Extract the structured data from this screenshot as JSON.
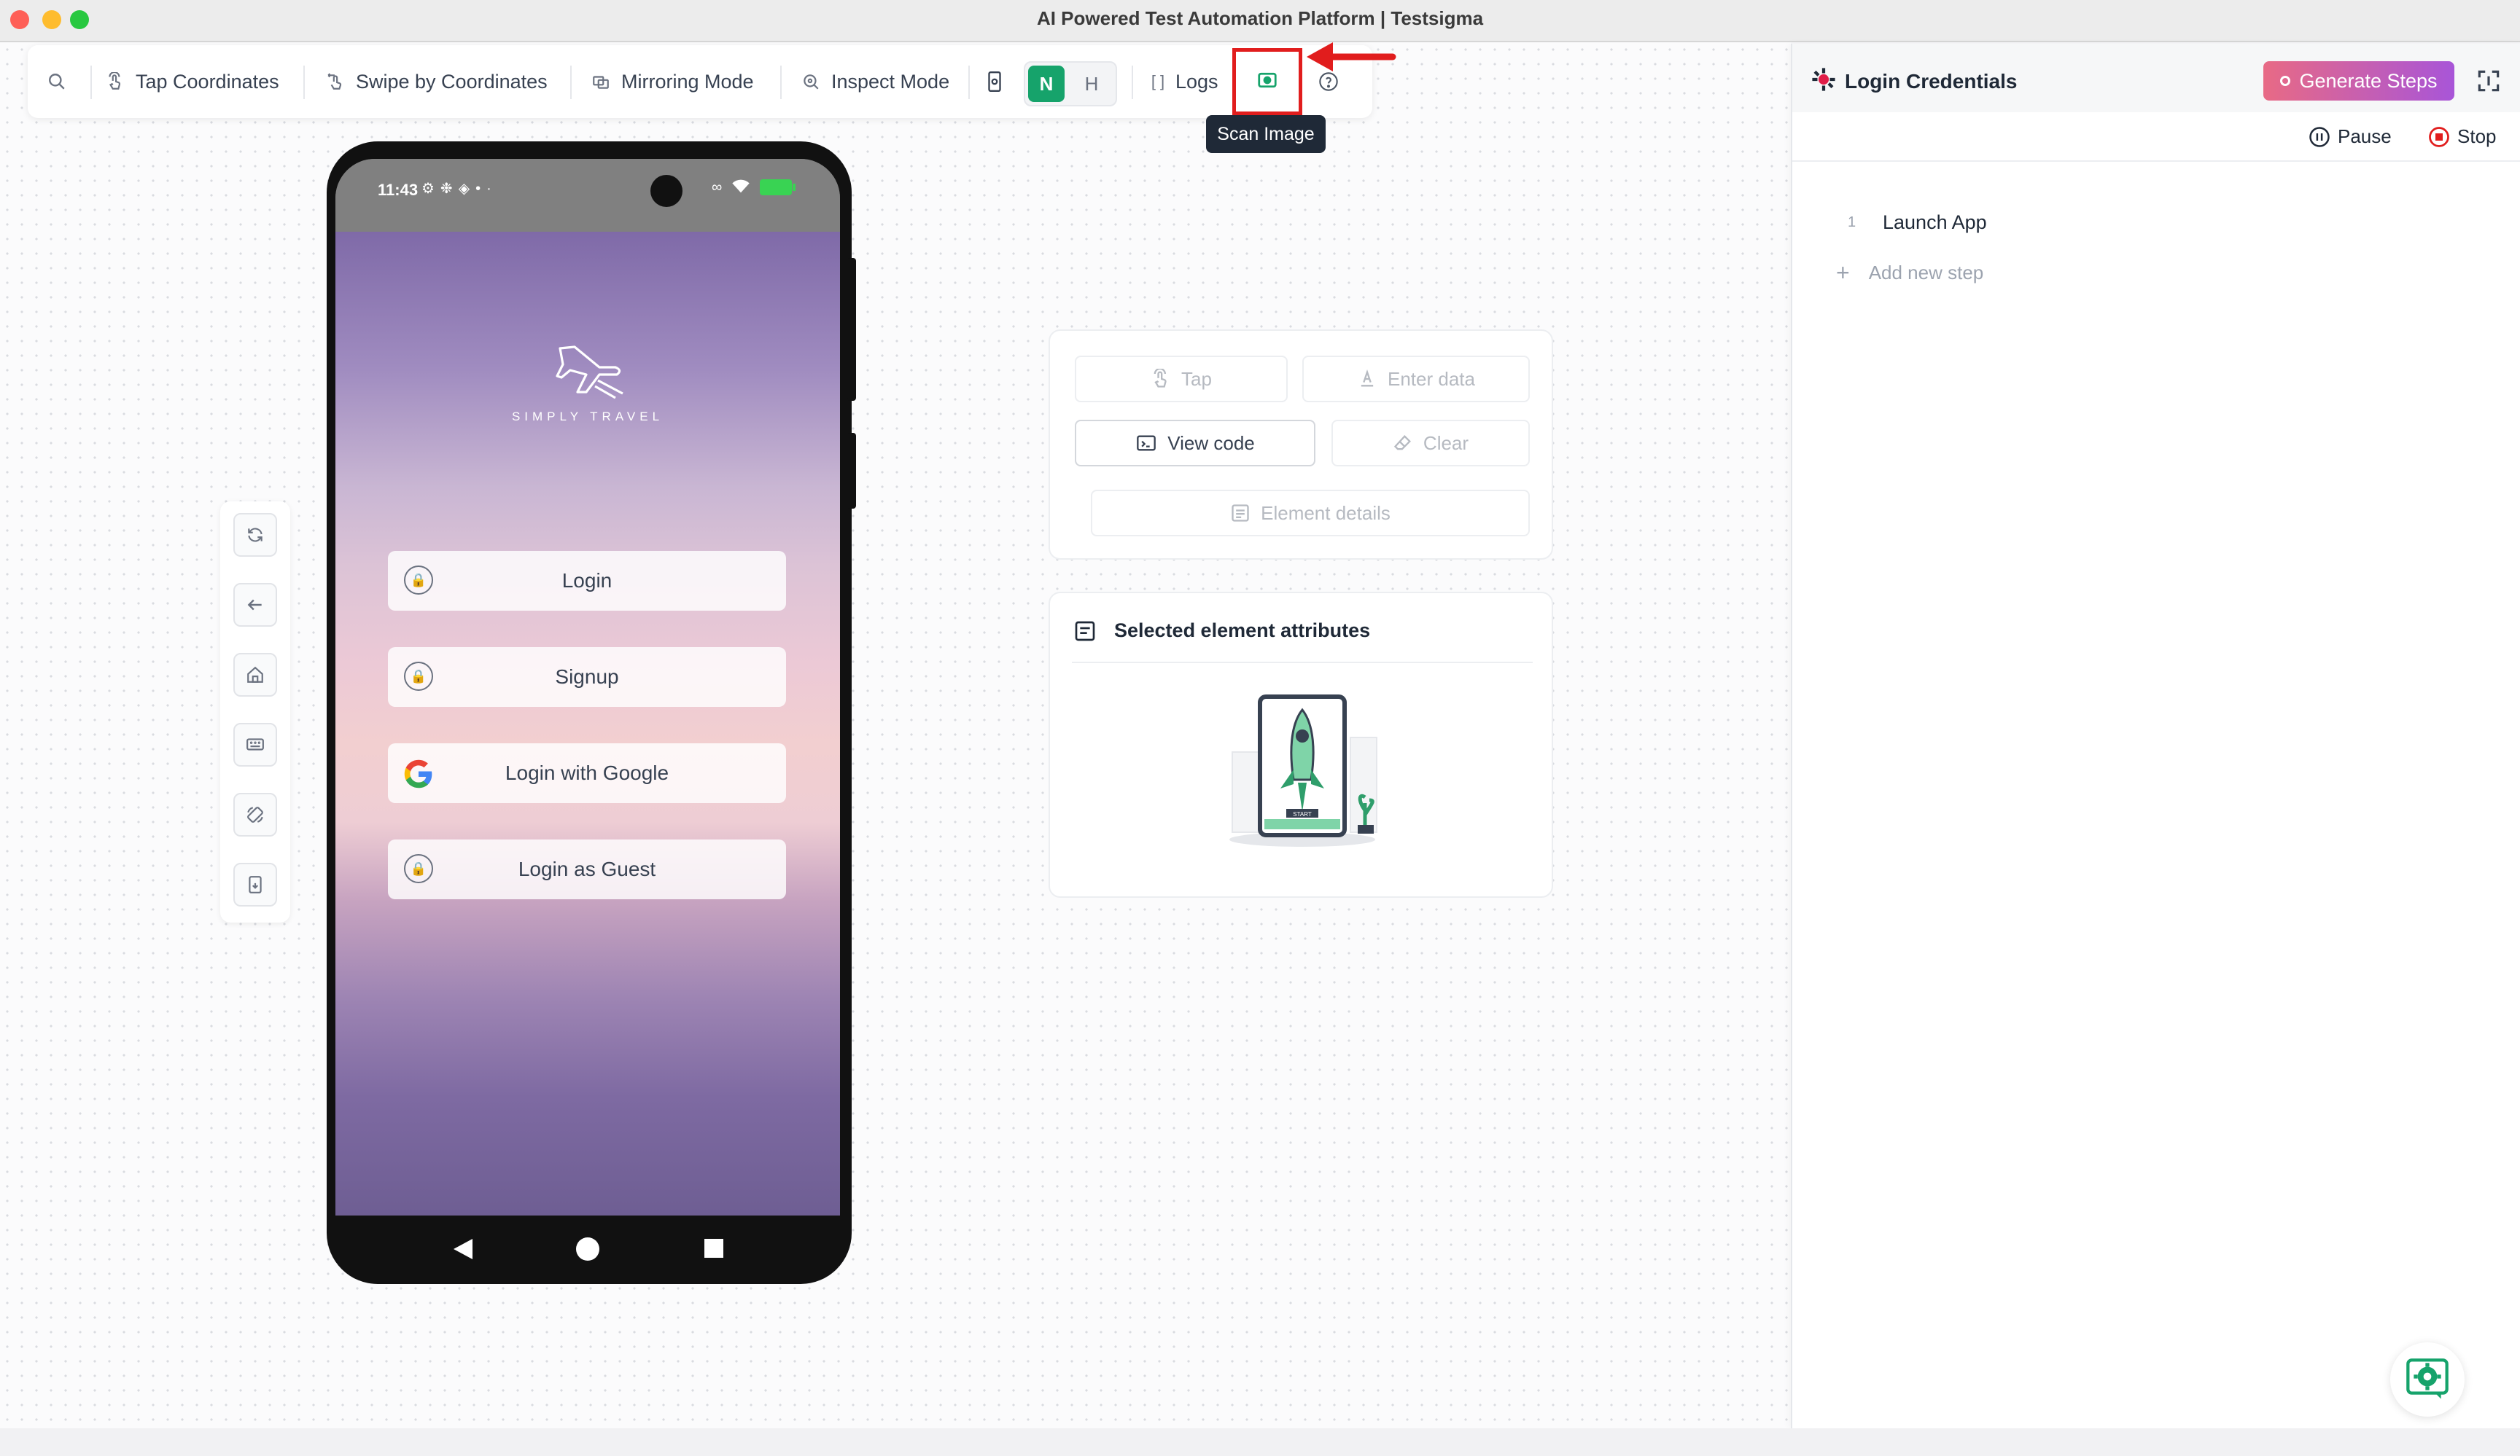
{
  "window": {
    "title": "AI Powered Test Automation Platform | Testsigma"
  },
  "toolbar": {
    "tap_coordinates": "Tap Coordinates",
    "swipe_by_coordinates": "Swipe by Coordinates",
    "mirroring_mode": "Mirroring Mode",
    "inspect_mode": "Inspect Mode",
    "mode_native": "N",
    "mode_hybrid": "H",
    "logs": "Logs",
    "scan_image_tooltip": "Scan Image"
  },
  "phone": {
    "status_time": "11:43",
    "app_brand": "SIMPLY TRAVEL",
    "buttons": {
      "login": "Login",
      "signup": "Signup",
      "login_google": "Login with Google",
      "login_guest": "Login as Guest"
    }
  },
  "actions": {
    "tap": "Tap",
    "enter_data": "Enter data",
    "view_code": "View code",
    "clear": "Clear",
    "element_details": "Element details"
  },
  "attributes": {
    "title": "Selected element attributes",
    "illustration_label": "START"
  },
  "right_panel": {
    "title": "Login Credentials",
    "generate_steps": "Generate Steps",
    "pause": "Pause",
    "stop": "Stop",
    "steps": [
      {
        "number": "1",
        "label": "Launch App"
      }
    ],
    "add_step": "Add new step"
  },
  "colors": {
    "accent_green": "#16a36b",
    "highlight_red": "#e11d1d",
    "generate_gradient_start": "#e86a85",
    "generate_gradient_end": "#a855d8"
  }
}
